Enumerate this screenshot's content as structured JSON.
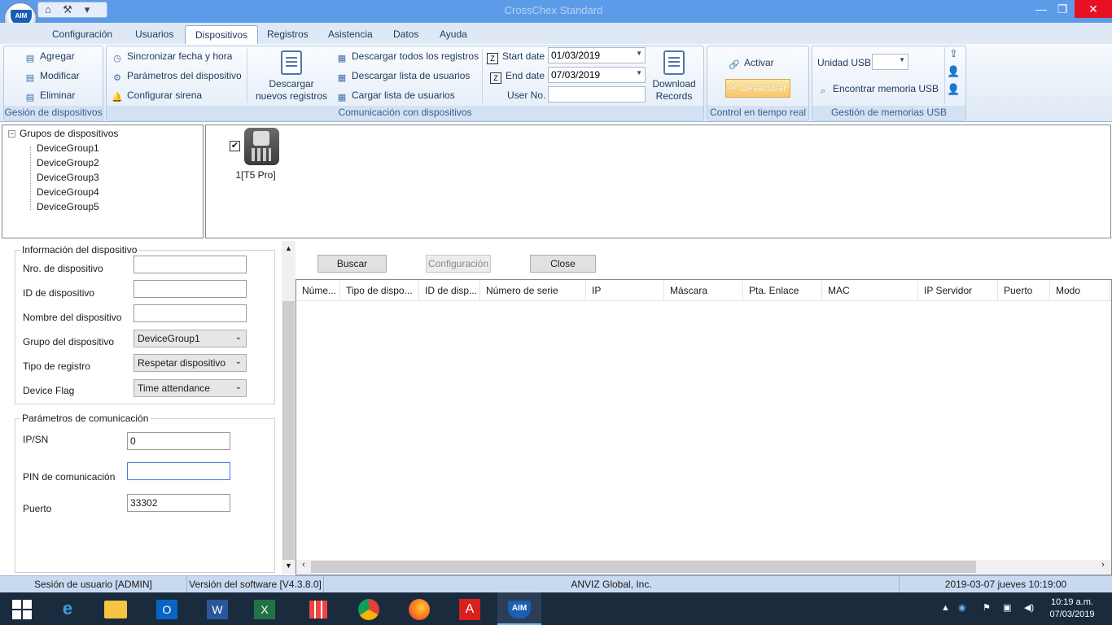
{
  "window": {
    "title": "CrossChex Standard",
    "minimize": "—",
    "maximize": "❐",
    "close": "✕"
  },
  "qat": {
    "home": "⌂",
    "tools": "⚒",
    "down": "▾"
  },
  "menu": {
    "tabs": [
      "Configuración",
      "Usuarios",
      "Dispositivos",
      "Registros",
      "Asistencia",
      "Datos",
      "Ayuda"
    ]
  },
  "ribbon": {
    "device_mgmt": {
      "add": "Agregar",
      "modify": "Modificar",
      "delete": "Eliminar",
      "label": "Gesión de dispositivos"
    },
    "comm": {
      "sync_time": "Sincronizar fecha y hora",
      "device_params": "Parámetros del dispositivo",
      "siren": "Configurar sirena",
      "download_new_1": "Descargar",
      "download_new_2": "nuevos registros",
      "download_all": "Descargar todos los registros",
      "download_users": "Descargar lista de usuarios",
      "upload_users": "Cargar lista de usuarios",
      "start_date_label": "Start date",
      "start_date": "01/03/2019",
      "end_date_label": "End date",
      "end_date": "07/03/2019",
      "user_no_label": "User No.",
      "user_no": "",
      "download_records_1": "Download",
      "download_records_2": "Records",
      "label": "Comunicación con dispositivos"
    },
    "realtime": {
      "activate": "Activar",
      "deactivate": "Desactivar",
      "label": "Control en tiempo real"
    },
    "usb": {
      "unit_label": "Unidad USB",
      "unit_value": "",
      "find": "Encontrar memoria USB",
      "label": "Gestión de memorias USB"
    }
  },
  "tree": {
    "root": "Grupos de dispositivos",
    "items": [
      "DeviceGroup1",
      "DeviceGroup2",
      "DeviceGroup3",
      "DeviceGroup4",
      "DeviceGroup5"
    ]
  },
  "device_card": {
    "label": "1[T5 Pro]",
    "checked": true
  },
  "device_info": {
    "legend": "Información del dispositivo",
    "number_label": "Nro. de dispositivo",
    "number": "",
    "id_label": "ID de dispositivo",
    "id": "",
    "name_label": "Nombre del dispositivo",
    "name": "",
    "group_label": "Grupo del dispositivo",
    "group": "DeviceGroup1",
    "record_type_label": "Tipo de registro",
    "record_type": "Respetar dispositivo",
    "flag_label": "Device Flag",
    "flag": "Time attendance"
  },
  "comm_params": {
    "legend": "Parámetros de comunicación",
    "ip_label": "IP/SN",
    "ip": "0",
    "pin_label": "PIN de comunicación",
    "pin": "",
    "port_label": "Puerto",
    "port": "33302"
  },
  "search_buttons": {
    "search": "Buscar",
    "config": "Configuración",
    "close": "Close"
  },
  "grid": {
    "columns": [
      "Núme...",
      "Tipo de dispo...",
      "ID de disp...",
      "Número de serie",
      "IP",
      "Máscara",
      "Pta. Enlace",
      "MAC",
      "IP Servidor",
      "Puerto",
      "Modo"
    ]
  },
  "status": {
    "session": "Sesión de usuario  [ADMIN]",
    "version": "Versión del software  [V4.3.8.0]",
    "company": "ANVIZ Global, Inc.",
    "datetime": "2019-03-07 jueves 10:19:00"
  },
  "taskbar": {
    "time": "10:19 a.m.",
    "date": "07/03/2019"
  },
  "colors": {
    "titlebar": "#5b9be8",
    "ribbon": "#dde8f5",
    "accent": "#1e395b",
    "status": "#c8daf0",
    "taskbar": "#1b2b3e"
  }
}
